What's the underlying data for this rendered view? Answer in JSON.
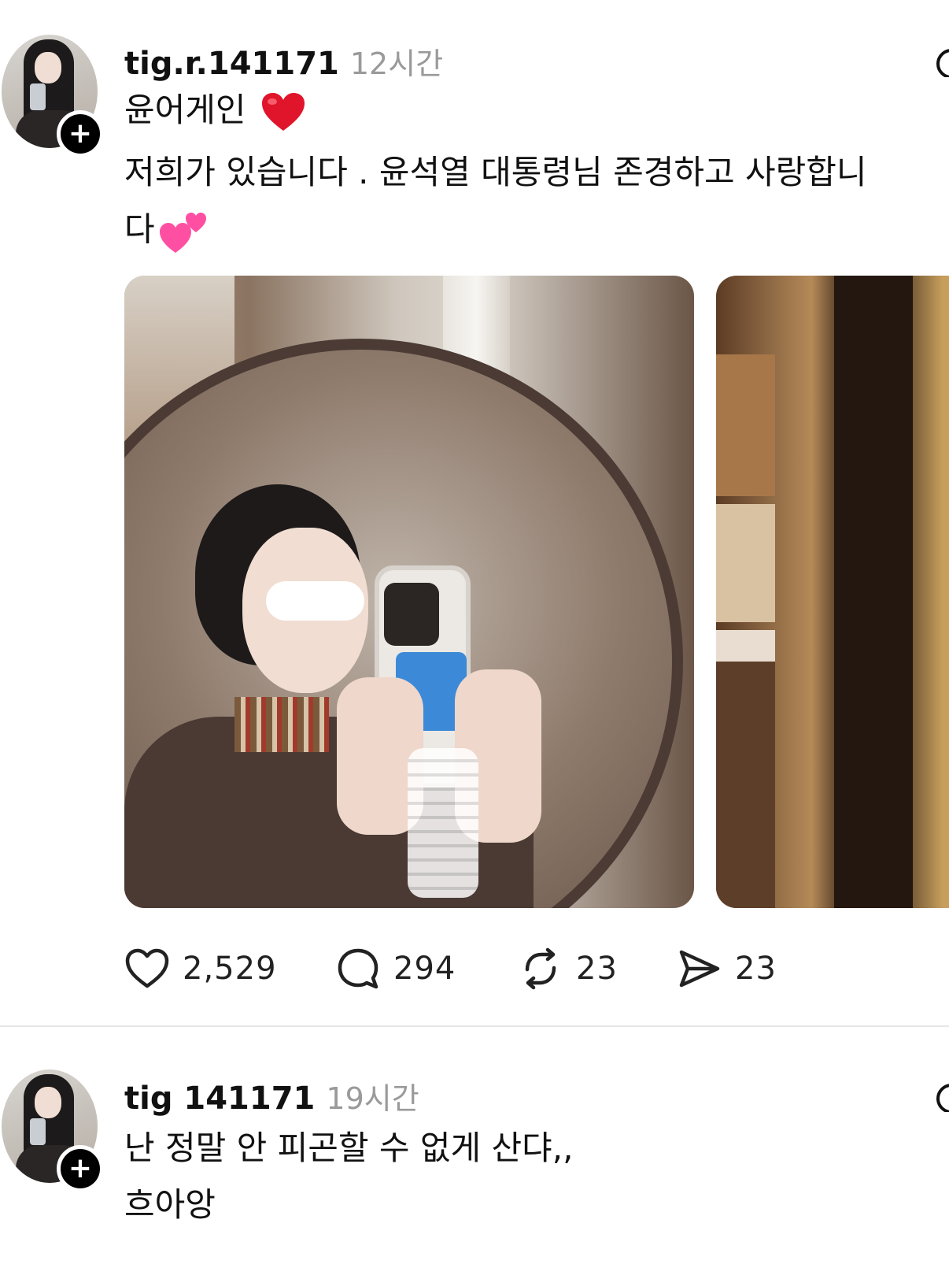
{
  "posts": [
    {
      "username": "tig.r.141171",
      "time": "12시간",
      "lines": [
        "윤어게인",
        "저희가 있습니다 . 윤석열 대통령님  존경하고 사랑합니",
        "다"
      ],
      "emoji": [
        "red-heart-emoji",
        "two-hearts-emoji"
      ],
      "media": [
        "selfie-mirror-photo",
        "room-photo"
      ],
      "actions": {
        "likes": "2,529",
        "comments": "294",
        "reposts": "23",
        "shares": "23"
      }
    },
    {
      "username": "tig  141171",
      "time": "19시간",
      "lines": [
        "난 정말 안 피곤할 수 없게 산댜,,",
        "흐아앙"
      ]
    }
  ],
  "icons": [
    "heart-icon",
    "comment-icon",
    "repost-icon",
    "share-icon",
    "more-icon",
    "follow-plus-icon"
  ],
  "colors": {
    "text": "#111111",
    "muted": "#9a9a9a",
    "divider": "#e6e6e6",
    "heart": "#e0142b",
    "pink_hearts": "#ff4fa3"
  }
}
